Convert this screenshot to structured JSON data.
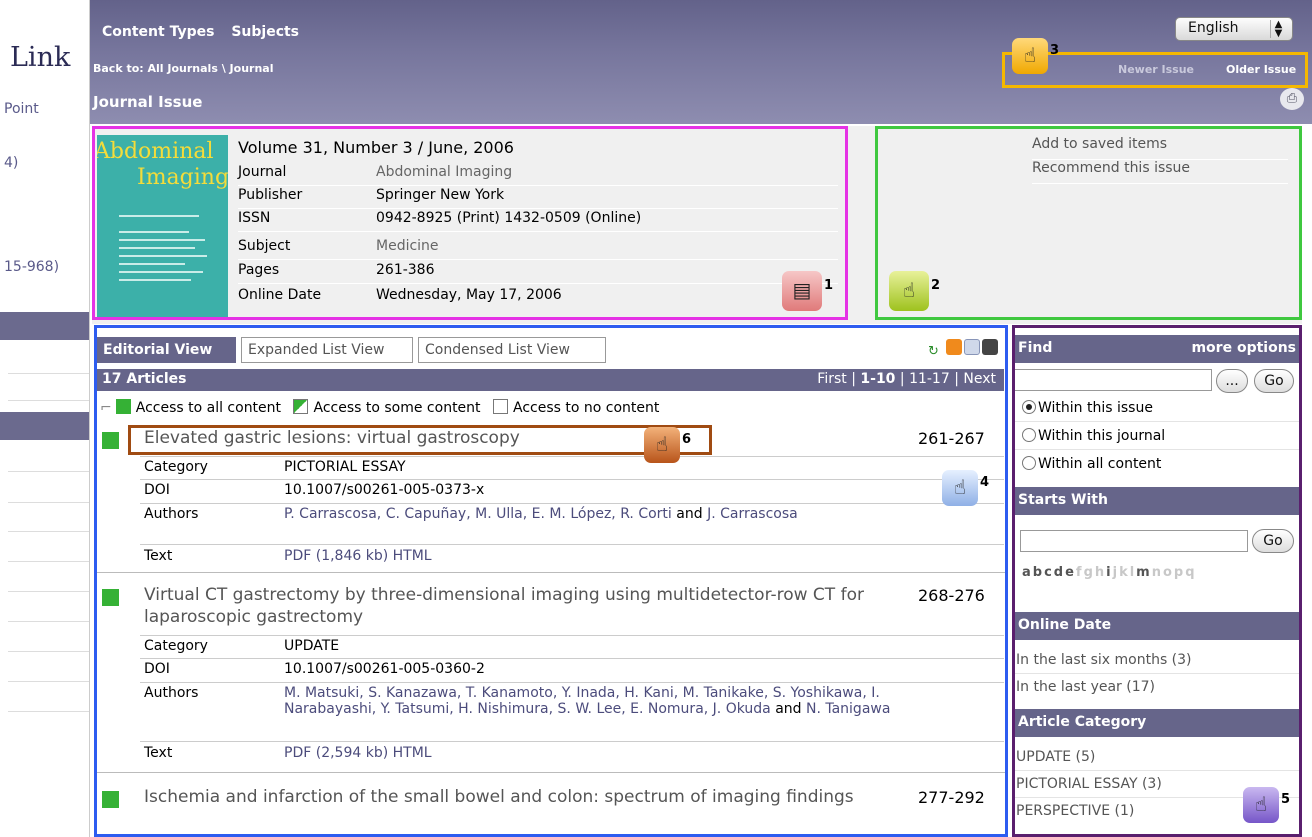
{
  "left_sidebar": {
    "logo_text": "Link",
    "items": [
      "Point",
      "4)",
      "15-968)"
    ]
  },
  "header": {
    "nav_content_types": "Content Types",
    "nav_subjects": "Subjects",
    "language": "English",
    "breadcrumb": "Back to:  All Journals \\ Journal",
    "newer_issue": "Newer Issue",
    "older_issue": "Older Issue",
    "page_title": "Journal Issue"
  },
  "issue": {
    "cover_title_1": "Abdominal",
    "cover_title_2": "Imaging",
    "volume_title": "Volume 31, Number 3 / June, 2006",
    "fields": [
      {
        "label": "Journal",
        "value": "Abdominal Imaging",
        "link": true
      },
      {
        "label": "Publisher",
        "value": "Springer New York",
        "link": false
      },
      {
        "label": "ISSN",
        "value": "0942-8925 (Print) 1432-0509 (Online)",
        "link": false
      },
      {
        "label": "Subject",
        "value": "Medicine",
        "link": true
      },
      {
        "label": "Pages",
        "value": "261-386",
        "link": false
      },
      {
        "label": "Online Date",
        "value": "Wednesday, May 17, 2006",
        "link": false
      }
    ],
    "add_saved": "Add to saved items",
    "recommend": "Recommend this issue"
  },
  "callouts": {
    "one": "1",
    "two": "2",
    "three": "3",
    "four": "4",
    "five": "5",
    "six": "6"
  },
  "list": {
    "tabs": [
      "Editorial View",
      "Expanded List View",
      "Condensed List View"
    ],
    "count": "17 Articles",
    "pager_first": "First",
    "pager_current": "1-10",
    "pager_next_range": "11-17",
    "pager_next": "Next",
    "legend_all": "Access to all content",
    "legend_some": "Access to some content",
    "legend_none": "Access to no content",
    "field_labels": {
      "category": "Category",
      "doi": "DOI",
      "authors": "Authors",
      "text": "Text"
    },
    "articles": [
      {
        "title": "Elevated gastric lesions: virtual gastroscopy",
        "pages": "261-267",
        "category": "PICTORIAL ESSAY",
        "doi": "10.1007/s00261-005-0373-x",
        "authors_a": "P. Carrascosa, C. Capuñay, M. Ulla, E. M. López, R. Corti",
        "authors_and": "and",
        "authors_b": "J. Carrascosa",
        "text": "PDF (1,846 kb)  HTML"
      },
      {
        "title": "Virtual CT gastrectomy by three-dimensional imaging using multidetector-row CT for laparoscopic gastrectomy",
        "pages": "268-276",
        "category": "UPDATE",
        "doi": "10.1007/s00261-005-0360-2",
        "authors_a": "M. Matsuki, S. Kanazawa, T. Kanamoto, Y. Inada, H. Kani, M. Tanikake, S. Yoshikawa, I. Narabayashi, Y. Tatsumi, H. Nishimura, S. W. Lee, E. Nomura, J. Okuda",
        "authors_and": "and",
        "authors_b": "N. Tanigawa",
        "text": "PDF (2,594 kb)  HTML"
      },
      {
        "title": "Ischemia and infarction of the small bowel and colon: spectrum of imaging findings",
        "pages": "277-292"
      }
    ]
  },
  "right_panel": {
    "find": "Find",
    "more_options": "more options",
    "dots_button": "...",
    "go": "Go",
    "radios": [
      "Within this issue",
      "Within this journal",
      "Within all content"
    ],
    "starts_with": "Starts With",
    "alphabet_on": "abcde",
    "alphabet_off1": "fgh",
    "alphabet_on2": "i",
    "alphabet_off2": "jkl",
    "alphabet_on3": "m",
    "alphabet_off3": "nopq",
    "online_date": "Online Date",
    "date_links": [
      "In the last six months (3)",
      "In the last year (17)"
    ],
    "article_category": "Article Category",
    "category_links": [
      "UPDATE (5)",
      "PICTORIAL ESSAY (3)",
      "PERSPECTIVE (1)"
    ]
  }
}
